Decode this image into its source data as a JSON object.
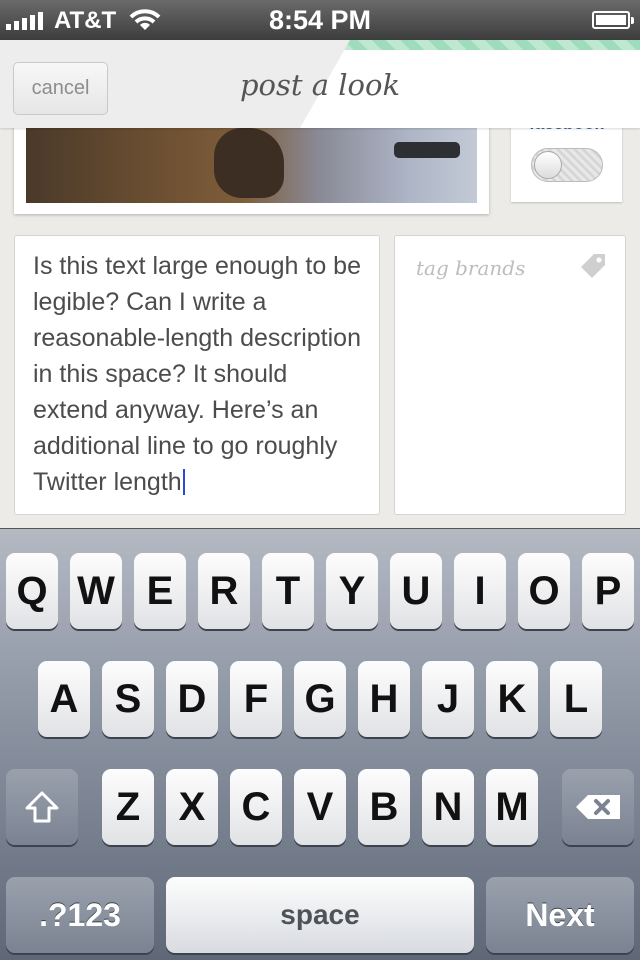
{
  "status_bar": {
    "carrier": "AT&T",
    "time": "8:54 PM"
  },
  "header": {
    "cancel_label": "cancel",
    "title": "post a look"
  },
  "share": {
    "service": "facebook",
    "toggle_on": false
  },
  "description": {
    "text": "Is this text large enough to be legible?  Can I write a reasonable-length description in this space?  It should extend anyway.  Here’s an additional line to go roughly Twitter length"
  },
  "tags": {
    "placeholder": "tag brands"
  },
  "keyboard": {
    "row1": [
      "Q",
      "W",
      "E",
      "R",
      "T",
      "Y",
      "U",
      "I",
      "O",
      "P"
    ],
    "row2": [
      "A",
      "S",
      "D",
      "F",
      "G",
      "H",
      "J",
      "K",
      "L"
    ],
    "row3": [
      "Z",
      "X",
      "C",
      "V",
      "B",
      "N",
      "M"
    ],
    "numbers_label": ".?123",
    "space_label": "space",
    "next_label": "Next"
  },
  "icons": {
    "signal": "signal-bars-icon",
    "wifi": "wifi-icon",
    "battery": "battery-icon",
    "tag": "tag-icon",
    "shift": "shift-icon",
    "backspace": "backspace-icon"
  },
  "colors": {
    "caret": "#2a4bd7",
    "facebook": "#3b5c9a",
    "header_pattern": "#9fdcbc"
  }
}
